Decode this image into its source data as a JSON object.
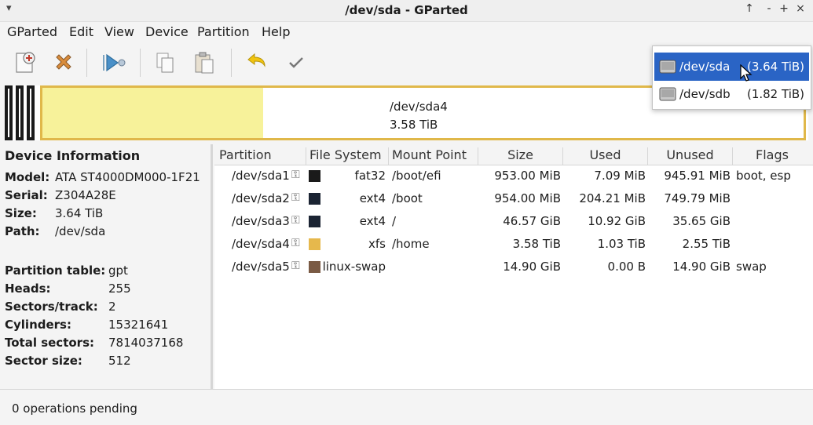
{
  "window": {
    "title": "/dev/sda - GParted",
    "menu_glyph": "▾",
    "controls": [
      "↑",
      "‑",
      "+",
      "×"
    ]
  },
  "menubar": [
    "GParted",
    "Edit",
    "View",
    "Device",
    "Partition",
    "Help"
  ],
  "partition_map": {
    "name": "/dev/sda4",
    "size": "3.58 TiB",
    "used_fraction": 0.29
  },
  "device_info": {
    "header": "Device Information",
    "rows1": [
      {
        "label": "Model:",
        "value": "ATA ST4000DM000-1F21"
      },
      {
        "label": "Serial:",
        "value": "Z304A28E"
      },
      {
        "label": "Size:",
        "value": "3.64 TiB"
      },
      {
        "label": "Path:",
        "value": "/dev/sda"
      }
    ],
    "rows2": [
      {
        "label": "Partition table:",
        "value": "gpt"
      },
      {
        "label": "Heads:",
        "value": "255"
      },
      {
        "label": "Sectors/track:",
        "value": "2"
      },
      {
        "label": "Cylinders:",
        "value": "15321641"
      },
      {
        "label": "Total sectors:",
        "value": "7814037168"
      },
      {
        "label": "Sector size:",
        "value": "512"
      }
    ]
  },
  "partition_table": {
    "columns": [
      "Partition",
      "File System",
      "Mount Point",
      "Size",
      "Used",
      "Unused",
      "Flags"
    ],
    "rows": [
      {
        "partition": "/dev/sda1",
        "fs": "fat32",
        "color": "#1a1a1a",
        "mount": "/boot/efi",
        "size": "953.00 MiB",
        "used": "7.09 MiB",
        "unused": "945.91 MiB",
        "flags": "boot, esp"
      },
      {
        "partition": "/dev/sda2",
        "fs": "ext4",
        "color": "#1b2433",
        "mount": "/boot",
        "size": "954.00 MiB",
        "used": "204.21 MiB",
        "unused": "749.79 MiB",
        "flags": ""
      },
      {
        "partition": "/dev/sda3",
        "fs": "ext4",
        "color": "#1b2433",
        "mount": "/",
        "size": "46.57 GiB",
        "used": "10.92 GiB",
        "unused": "35.65 GiB",
        "flags": ""
      },
      {
        "partition": "/dev/sda4",
        "fs": "xfs",
        "color": "#e6b84c",
        "mount": "/home",
        "size": "3.58 TiB",
        "used": "1.03 TiB",
        "unused": "2.55 TiB",
        "flags": ""
      },
      {
        "partition": "/dev/sda5",
        "fs": "linux-swap",
        "color": "#7a5a44",
        "mount": "",
        "size": "14.90 GiB",
        "used": "0.00 B",
        "unused": "14.90 GiB",
        "flags": "swap"
      }
    ]
  },
  "status": {
    "text": "0 operations pending"
  },
  "device_dropdown": {
    "items": [
      {
        "name": "/dev/sda",
        "size": "(3.64 TiB)",
        "selected": true
      },
      {
        "name": "/dev/sdb",
        "size": "(1.82 TiB)",
        "selected": false
      }
    ]
  },
  "colors": {
    "accent": "#2a64c5",
    "xfs": "#e6b84c",
    "used_fill": "#f7f29a"
  }
}
